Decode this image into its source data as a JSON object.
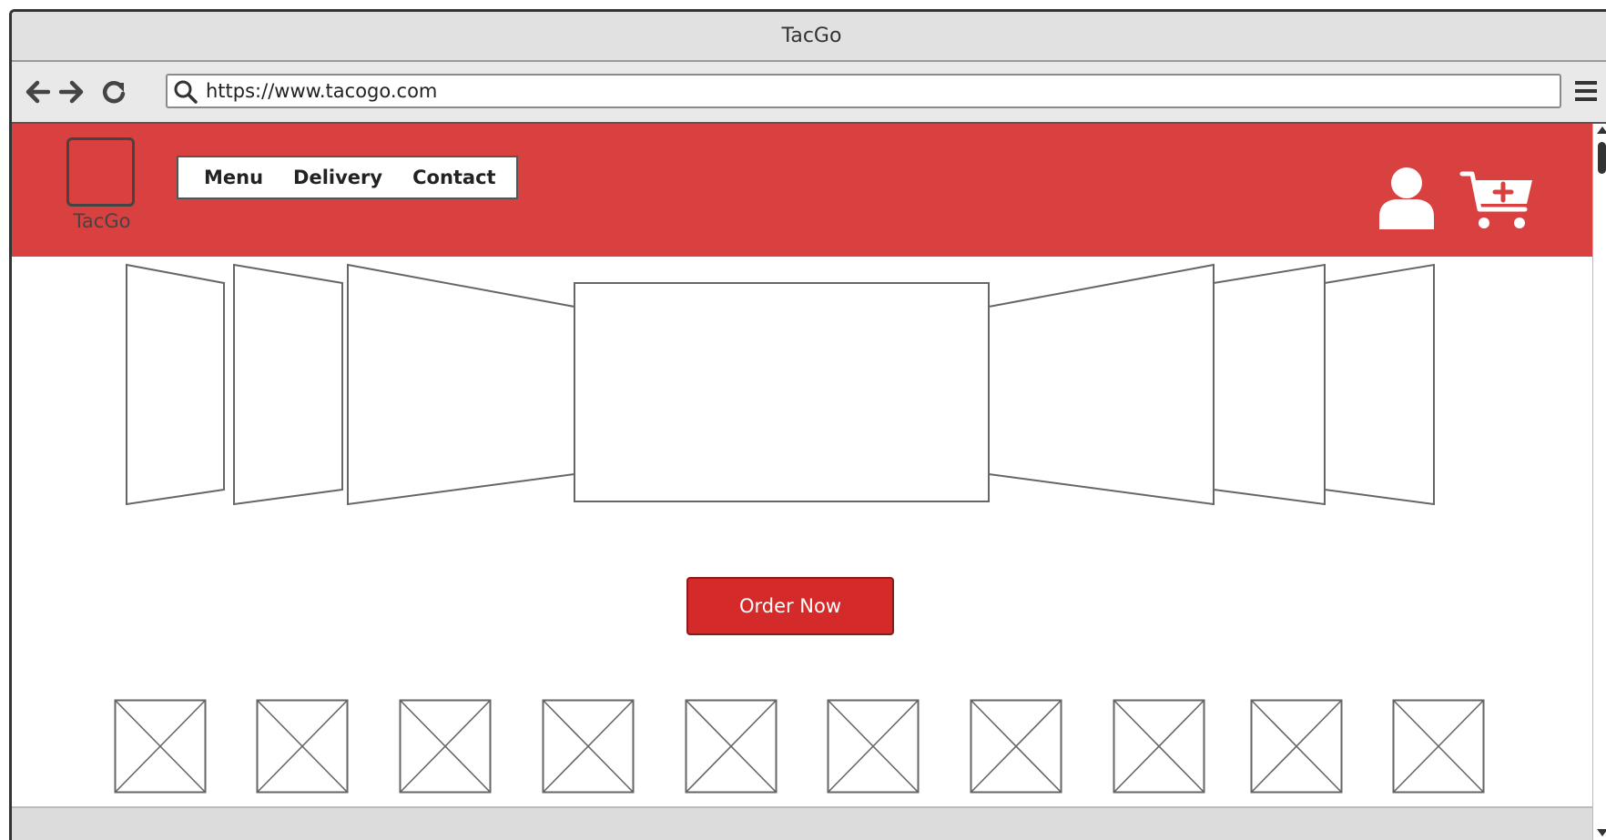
{
  "window": {
    "title": "TacGo"
  },
  "toolbar": {
    "back_icon": "arrow-left-icon",
    "forward_icon": "arrow-right-icon",
    "reload_icon": "reload-icon",
    "url": "https://www.tacogo.com",
    "menu_icon": "hamburger-icon"
  },
  "header": {
    "brand": "TacGo",
    "nav": [
      {
        "label": "Menu"
      },
      {
        "label": "Delivery"
      },
      {
        "label": "Contact"
      }
    ],
    "user_icon": "user-icon",
    "cart_icon": "cart-add-icon"
  },
  "hero": {
    "slides": 7,
    "cta_label": "Order Now"
  },
  "thumbnails": {
    "count": 10
  },
  "colors": {
    "brand_red": "#d94040",
    "button_red": "#d42a2a",
    "chrome_gray": "#e1e1e1",
    "wire_gray": "#666666"
  }
}
